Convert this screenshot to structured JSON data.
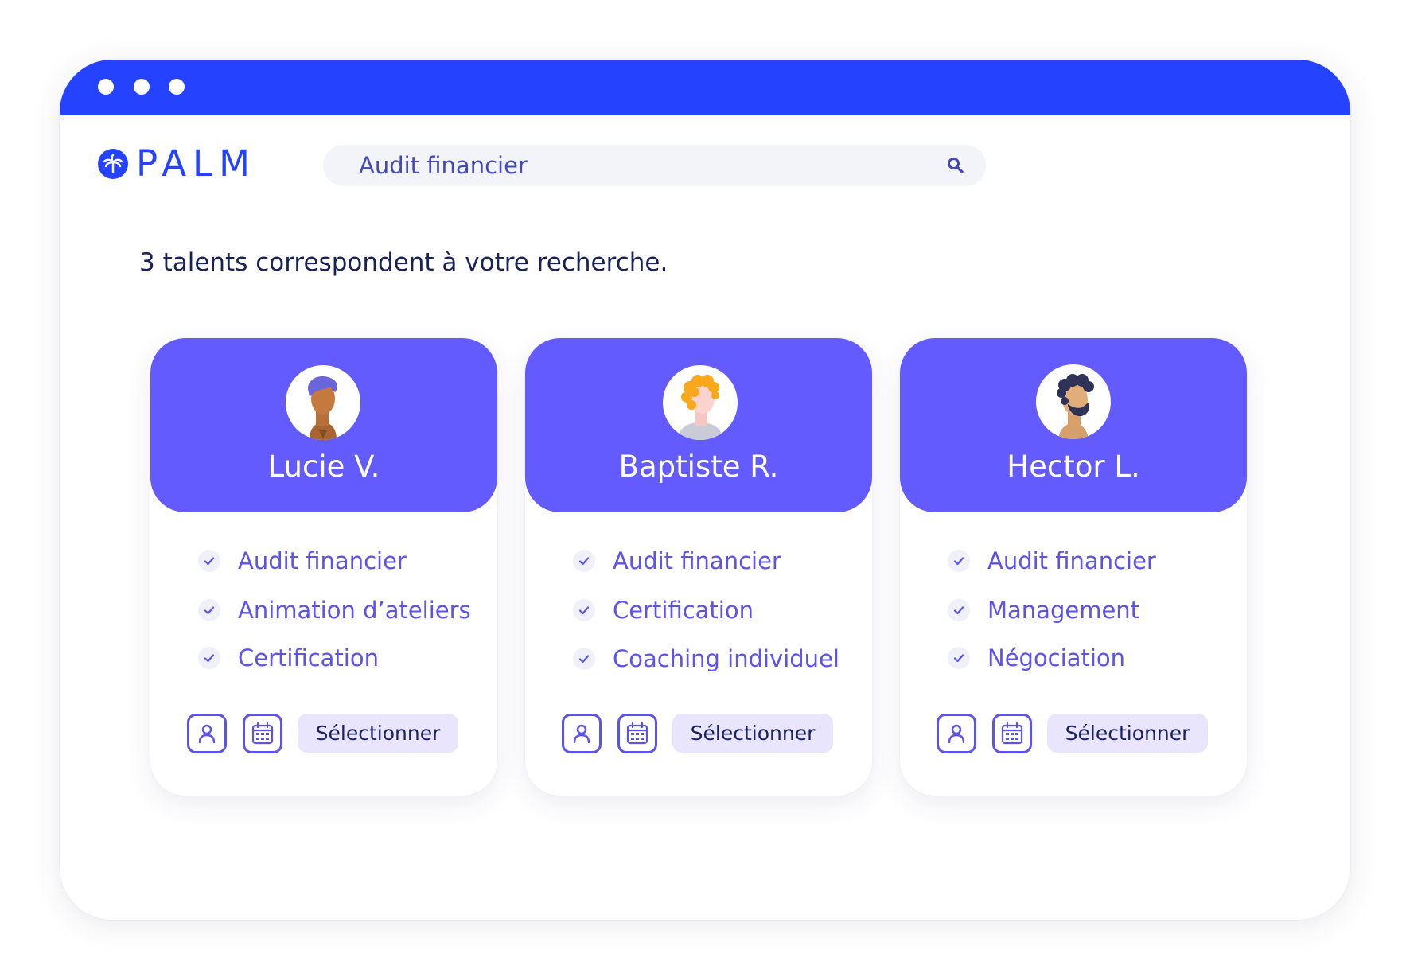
{
  "window": {
    "title_bar_dots": 3,
    "accent_color": "#2543fe",
    "card_color": "#645bfe"
  },
  "logo": {
    "icon": "palm-tree-icon",
    "text": "PALM"
  },
  "search": {
    "value": "Audit financier",
    "icon": "search-icon"
  },
  "results": {
    "summary": "3 talents correspondent à votre recherche."
  },
  "cards": [
    {
      "name": "Lucie V.",
      "skills": [
        "Audit financier",
        "Animation d’ateliers",
        "Certification"
      ],
      "profile_icon": "user-icon",
      "calendar_icon": "calendar-icon",
      "select_label": "Sélectionner"
    },
    {
      "name": "Baptiste R.",
      "skills": [
        "Audit financier",
        "Certification",
        "Coaching individuel"
      ],
      "profile_icon": "user-icon",
      "calendar_icon": "calendar-icon",
      "select_label": "Sélectionner"
    },
    {
      "name": "Hector L.",
      "skills": [
        "Audit financier",
        "Management",
        "Négociation"
      ],
      "profile_icon": "user-icon",
      "calendar_icon": "calendar-icon",
      "select_label": "Sélectionner"
    }
  ]
}
